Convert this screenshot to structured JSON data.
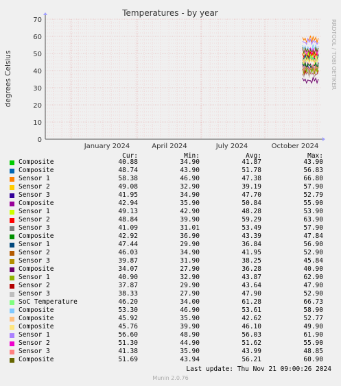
{
  "chart_data": {
    "type": "line",
    "title": "Temperatures - by year",
    "ylabel": "degrees Celsius",
    "ylim": [
      0,
      70
    ],
    "yticks": [
      0,
      10,
      20,
      30,
      40,
      50,
      60,
      70
    ],
    "xticks": [
      "January 2024",
      "April 2024",
      "July 2024",
      "October 2024"
    ],
    "watermark": "RRDTOOL / TOBI OETIKER",
    "grid": true,
    "columns": [
      "Cur:",
      "Min:",
      "Avg:",
      "Max:"
    ],
    "series": [
      {
        "name": "Composite",
        "color": "#00cc00",
        "cur": "40.88",
        "min": "34.90",
        "avg": "41.87",
        "max": "43.90"
      },
      {
        "name": "Composite",
        "color": "#0066b3",
        "cur": "48.74",
        "min": "43.90",
        "avg": "51.78",
        "max": "56.83"
      },
      {
        "name": "Sensor 1",
        "color": "#ff8000",
        "cur": "58.38",
        "min": "46.90",
        "avg": "47.38",
        "max": "66.80"
      },
      {
        "name": "Sensor 2",
        "color": "#ffcc00",
        "cur": "49.08",
        "min": "32.90",
        "avg": "39.19",
        "max": "57.90"
      },
      {
        "name": "Sensor 3",
        "color": "#330099",
        "cur": "41.95",
        "min": "34.90",
        "avg": "47.70",
        "max": "52.79"
      },
      {
        "name": "Composite",
        "color": "#990099",
        "cur": "42.94",
        "min": "35.90",
        "avg": "50.84",
        "max": "55.90"
      },
      {
        "name": "Sensor 1",
        "color": "#ccff00",
        "cur": "49.13",
        "min": "42.90",
        "avg": "48.28",
        "max": "53.90"
      },
      {
        "name": "Sensor 2",
        "color": "#ff0000",
        "cur": "48.84",
        "min": "39.90",
        "avg": "59.29",
        "max": "63.90"
      },
      {
        "name": "Sensor 3",
        "color": "#808080",
        "cur": "41.09",
        "min": "31.01",
        "avg": "53.49",
        "max": "57.90"
      },
      {
        "name": "Composite",
        "color": "#008f00",
        "cur": "42.92",
        "min": "36.90",
        "avg": "43.39",
        "max": "47.84"
      },
      {
        "name": "Sensor 1",
        "color": "#00487d",
        "cur": "47.44",
        "min": "29.90",
        "avg": "36.84",
        "max": "56.90"
      },
      {
        "name": "Sensor 2",
        "color": "#b35a00",
        "cur": "46.03",
        "min": "34.90",
        "avg": "41.95",
        "max": "52.90"
      },
      {
        "name": "Sensor 3",
        "color": "#b38f00",
        "cur": "39.87",
        "min": "31.90",
        "avg": "38.25",
        "max": "45.84"
      },
      {
        "name": "Composite",
        "color": "#6b006b",
        "cur": "34.07",
        "min": "27.90",
        "avg": "36.28",
        "max": "40.90"
      },
      {
        "name": "Sensor 1",
        "color": "#8fb300",
        "cur": "40.90",
        "min": "32.90",
        "avg": "43.87",
        "max": "62.90"
      },
      {
        "name": "Sensor 2",
        "color": "#b30000",
        "cur": "37.87",
        "min": "29.90",
        "avg": "43.64",
        "max": "47.90"
      },
      {
        "name": "Sensor 3",
        "color": "#bebebe",
        "cur": "38.33",
        "min": "27.90",
        "avg": "47.90",
        "max": "52.90"
      },
      {
        "name": "SoC Temperature",
        "color": "#80ff80",
        "cur": "46.20",
        "min": "34.00",
        "avg": "61.28",
        "max": "66.73"
      },
      {
        "name": "Composite",
        "color": "#80c9ff",
        "cur": "53.30",
        "min": "46.90",
        "avg": "53.61",
        "max": "58.90"
      },
      {
        "name": "Composite",
        "color": "#ffc080",
        "cur": "45.92",
        "min": "35.90",
        "avg": "42.62",
        "max": "52.77"
      },
      {
        "name": "Composite",
        "color": "#ffe680",
        "cur": "45.76",
        "min": "39.90",
        "avg": "46.10",
        "max": "49.90"
      },
      {
        "name": "Sensor 1",
        "color": "#aa80ff",
        "cur": "56.60",
        "min": "48.90",
        "avg": "56.03",
        "max": "61.90"
      },
      {
        "name": "Sensor 2",
        "color": "#ee00cc",
        "cur": "51.30",
        "min": "44.90",
        "avg": "51.62",
        "max": "55.90"
      },
      {
        "name": "Sensor 3",
        "color": "#ff8080",
        "cur": "41.38",
        "min": "35.90",
        "avg": "43.99",
        "max": "48.85"
      },
      {
        "name": "Composite",
        "color": "#666600",
        "cur": "51.69",
        "min": "43.94",
        "avg": "56.21",
        "max": "60.90"
      }
    ]
  },
  "footer": {
    "last_update": "Last update: Thu Nov 21 09:00:26 2024",
    "munin": "Munin 2.0.76"
  }
}
